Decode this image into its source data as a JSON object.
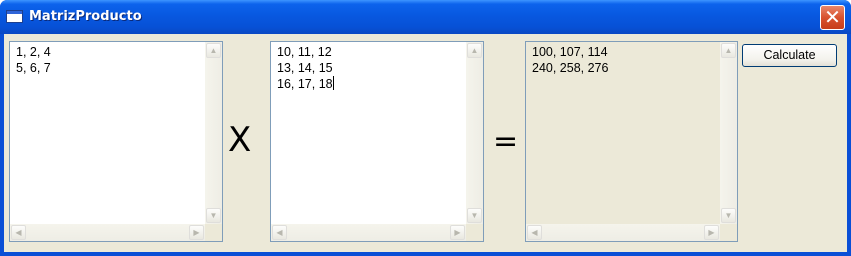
{
  "window": {
    "title": "MatrizProducto",
    "close_glyph": "✕"
  },
  "matrix_a": {
    "text": "1, 2, 4\n5, 6, 7"
  },
  "operator_multiply": "X",
  "matrix_b": {
    "text": "10, 11, 12\n13, 14, 15\n16, 17, 18"
  },
  "operator_equals": "=",
  "result": {
    "text": "100, 107, 114\n240, 258, 276"
  },
  "calculate_button": {
    "label": "Calculate"
  },
  "icons": {
    "scroll_up": "▲",
    "scroll_down": "▼",
    "scroll_left": "◀",
    "scroll_right": "▶"
  },
  "colors": {
    "titlebar": "#0858e0",
    "client_bg": "#ece9d8",
    "close_button": "#d8522f",
    "readonly_bg": "#ece9d8"
  }
}
